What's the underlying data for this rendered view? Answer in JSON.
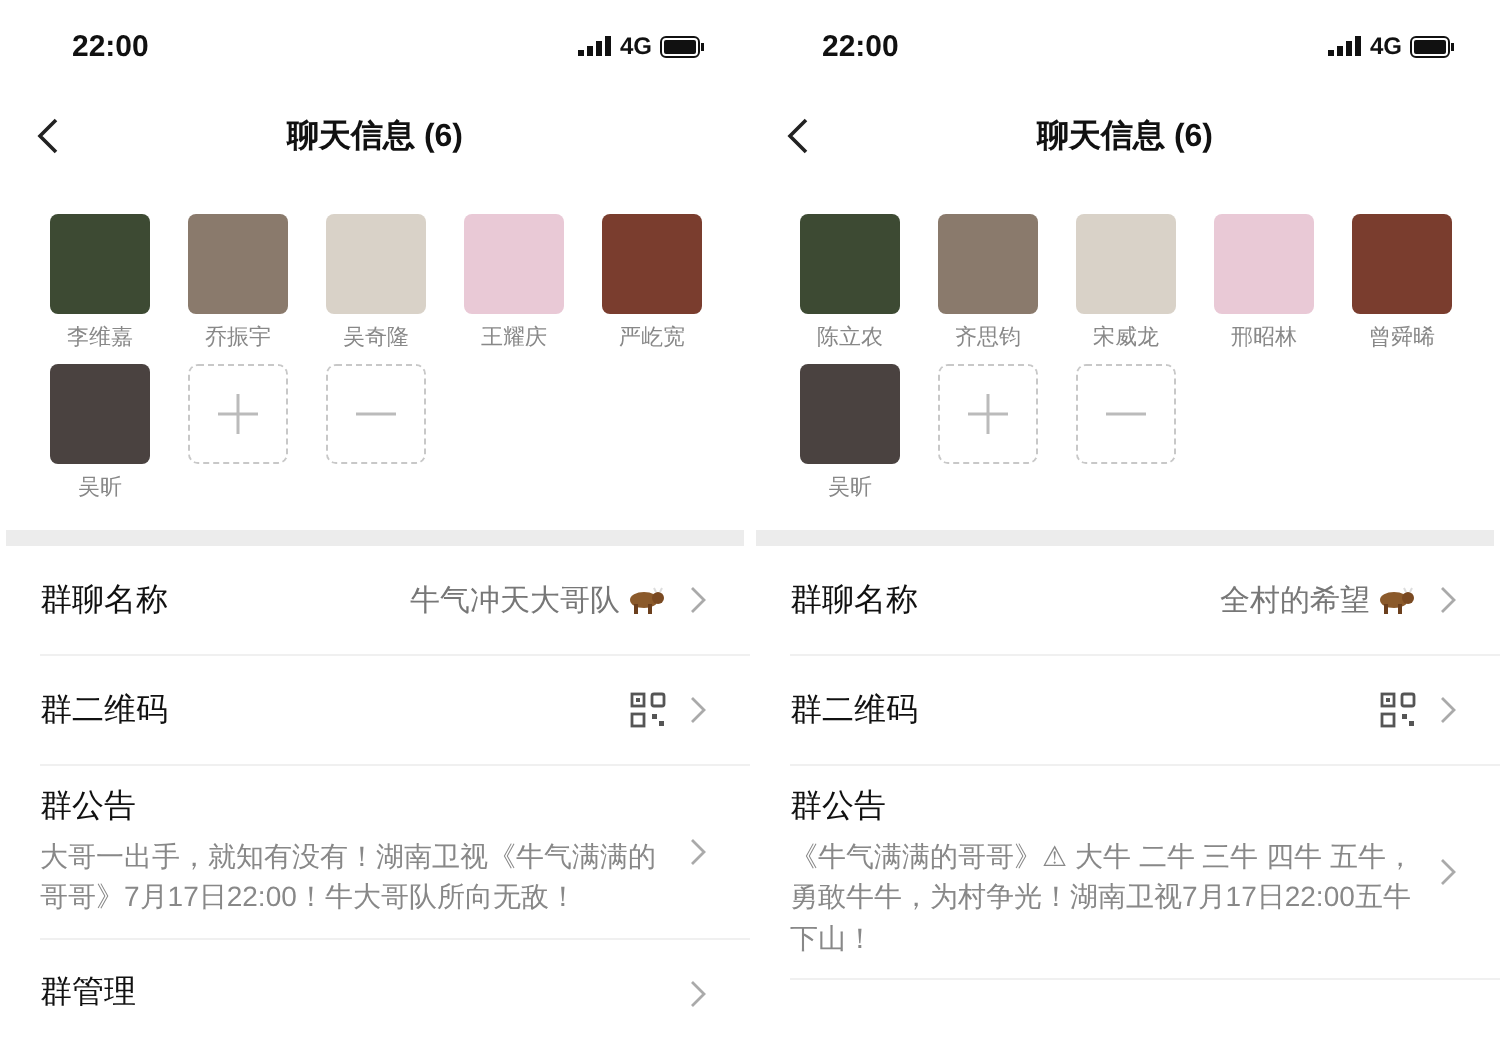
{
  "screens": [
    {
      "status_bar": {
        "time": "22:00",
        "network": "4G"
      },
      "title": "聊天信息 (6)",
      "members": [
        {
          "name": "李维嘉"
        },
        {
          "name": "乔振宇"
        },
        {
          "name": "吴奇隆"
        },
        {
          "name": "王耀庆"
        },
        {
          "name": "严屹宽"
        },
        {
          "name": "吴昕"
        }
      ],
      "rows": [
        {
          "kind": "value",
          "label": "群聊名称",
          "value": "牛气冲天大哥队"
        },
        {
          "kind": "qr",
          "label": "群二维码"
        },
        {
          "kind": "notice",
          "label": "群公告",
          "text": "大哥一出手，就知有没有！湖南卫视《牛气满满的哥哥》7月17日22:00！牛大哥队所向无敌！"
        },
        {
          "kind": "plain",
          "label": "群管理"
        }
      ]
    },
    {
      "status_bar": {
        "time": "22:00",
        "network": "4G"
      },
      "title": "聊天信息 (6)",
      "members": [
        {
          "name": "陈立农"
        },
        {
          "name": "齐思钧"
        },
        {
          "name": "宋威龙"
        },
        {
          "name": "邢昭林"
        },
        {
          "name": "曾舜晞"
        },
        {
          "name": "吴昕"
        }
      ],
      "rows": [
        {
          "kind": "value",
          "label": "群聊名称",
          "value": "全村的希望"
        },
        {
          "kind": "qr",
          "label": "群二维码"
        },
        {
          "kind": "notice",
          "label": "群公告",
          "text": "《牛气满满的哥哥》⚠ 大牛 二牛 三牛 四牛 五牛，勇敢牛牛，为村争光！湖南卫视7月17日22:00五牛下山！"
        }
      ]
    }
  ]
}
